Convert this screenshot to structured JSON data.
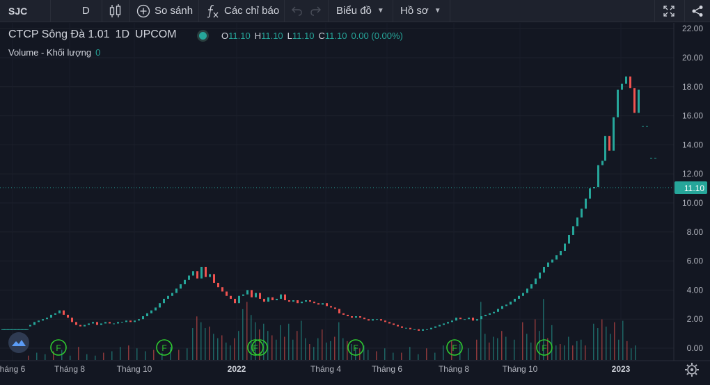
{
  "toolbar": {
    "symbol": "SJC",
    "interval": "D",
    "compare_label": "So sánh",
    "indicators_label": "Các chỉ báo",
    "chart_label": "Biểu đồ",
    "profile_label": "Hồ sơ"
  },
  "legend": {
    "name": "CTCP Sông Đà 1.01",
    "interval": "1D",
    "exchange": "UPCOM",
    "o_label": "O",
    "o": "11.10",
    "h_label": "H",
    "h": "11.10",
    "l_label": "L",
    "l": "11.10",
    "c_label": "C",
    "c": "11.10",
    "change": "0.00 (0.00%)",
    "volume_label": "Volume - Khối lượng",
    "volume_value": "0"
  },
  "colors": {
    "up": "#26a69a",
    "down": "#ef5350",
    "accent": "#26a69a",
    "bg": "#131722",
    "event": "#2fcc2f"
  },
  "chart_data": {
    "type": "candlestick",
    "y_ticks": [
      "22.00",
      "20.00",
      "18.00",
      "16.00",
      "14.00",
      "12.00",
      "10.00",
      "8.00",
      "6.00",
      "4.00",
      "2.00",
      "0.00"
    ],
    "ylim": [
      0,
      22
    ],
    "current_price_label": "11.10",
    "current_price": 11.1,
    "x_labels": [
      "háng 6",
      "Tháng 8",
      "Tháng 10",
      "2022",
      "Tháng 4",
      "Tháng 6",
      "Tháng 8",
      "Tháng 10",
      "2023"
    ],
    "event_markers": [
      "F",
      "F",
      "F",
      "F",
      "F",
      "F"
    ],
    "price_series": [
      [
        2,
        1.3,
        1.3
      ],
      [
        4,
        1.3,
        1.3
      ],
      [
        6,
        1.3,
        1.3
      ],
      [
        8,
        1.3,
        1.3
      ],
      [
        10,
        1.3,
        1.3
      ],
      [
        12,
        1.3,
        1.3
      ],
      [
        14,
        1.3,
        1.3
      ],
      [
        16,
        1.3,
        1.3
      ],
      [
        18,
        1.3,
        1.3
      ],
      [
        20,
        1.3,
        1.3
      ],
      [
        22,
        1.3,
        1.3
      ],
      [
        24,
        1.3,
        1.3
      ],
      [
        26,
        1.3,
        1.3
      ],
      [
        28,
        1.3,
        1.3
      ],
      [
        30,
        1.3,
        1.3
      ],
      [
        32,
        1.3,
        1.3
      ],
      [
        34,
        1.3,
        1.3
      ],
      [
        36,
        1.3,
        1.3
      ],
      [
        38,
        1.3,
        1.3
      ],
      [
        42,
        1.5,
        1.6
      ],
      [
        48,
        1.6,
        1.8
      ],
      [
        54,
        1.8,
        1.9
      ],
      [
        60,
        1.9,
        2.0
      ],
      [
        66,
        2.0,
        2.1
      ],
      [
        72,
        2.1,
        2.3
      ],
      [
        78,
        2.3,
        2.4
      ],
      [
        84,
        2.4,
        2.6
      ],
      [
        90,
        2.6,
        2.3
      ],
      [
        96,
        2.3,
        2.1
      ],
      [
        102,
        2.1,
        1.8
      ],
      [
        108,
        1.8,
        1.6
      ],
      [
        114,
        1.6,
        1.5
      ],
      [
        120,
        1.5,
        1.6
      ],
      [
        126,
        1.6,
        1.7
      ],
      [
        132,
        1.7,
        1.8
      ],
      [
        138,
        1.8,
        1.6
      ],
      [
        144,
        1.6,
        1.7
      ],
      [
        150,
        1.7,
        1.8
      ],
      [
        156,
        1.8,
        1.7
      ],
      [
        162,
        1.7,
        1.7
      ],
      [
        168,
        1.7,
        1.8
      ],
      [
        174,
        1.8,
        1.8
      ],
      [
        180,
        1.8,
        1.9
      ],
      [
        186,
        1.9,
        1.8
      ],
      [
        192,
        1.8,
        1.9
      ],
      [
        198,
        1.9,
        2.0
      ],
      [
        204,
        2.0,
        2.2
      ],
      [
        210,
        2.2,
        2.4
      ],
      [
        216,
        2.4,
        2.6
      ],
      [
        222,
        2.6,
        2.8
      ],
      [
        228,
        2.8,
        3.1
      ],
      [
        234,
        3.1,
        3.4
      ],
      [
        240,
        3.4,
        3.6
      ],
      [
        246,
        3.6,
        3.8
      ],
      [
        252,
        3.8,
        4.1
      ],
      [
        258,
        4.1,
        4.4
      ],
      [
        264,
        4.4,
        4.7
      ],
      [
        270,
        4.7,
        5.0
      ],
      [
        276,
        5.0,
        5.3
      ],
      [
        282,
        5.3,
        4.8
      ],
      [
        288,
        4.8,
        5.6
      ],
      [
        294,
        5.6,
        4.9
      ],
      [
        300,
        4.9,
        5.1
      ],
      [
        306,
        5.1,
        4.5
      ],
      [
        312,
        4.5,
        4.2
      ],
      [
        318,
        4.2,
        3.9
      ],
      [
        324,
        3.9,
        3.6
      ],
      [
        330,
        3.6,
        3.4
      ],
      [
        336,
        3.4,
        3.1
      ],
      [
        342,
        3.1,
        3.6
      ],
      [
        348,
        3.6,
        3.7
      ],
      [
        354,
        3.7,
        4.0
      ],
      [
        360,
        4.0,
        3.5
      ],
      [
        366,
        3.5,
        3.8
      ],
      [
        372,
        3.8,
        3.4
      ],
      [
        378,
        3.4,
        3.2
      ],
      [
        384,
        3.2,
        3.5
      ],
      [
        390,
        3.5,
        3.3
      ],
      [
        396,
        3.3,
        3.4
      ],
      [
        402,
        3.4,
        3.7
      ],
      [
        408,
        3.7,
        3.3
      ],
      [
        414,
        3.3,
        3.2
      ],
      [
        420,
        3.2,
        3.3
      ],
      [
        426,
        3.3,
        3.1
      ],
      [
        432,
        3.1,
        3.2
      ],
      [
        438,
        3.2,
        3.3
      ],
      [
        444,
        3.3,
        3.2
      ],
      [
        450,
        3.2,
        3.1
      ],
      [
        456,
        3.1,
        3.0
      ],
      [
        462,
        3.0,
        3.1
      ],
      [
        468,
        3.1,
        2.9
      ],
      [
        474,
        2.9,
        2.8
      ],
      [
        480,
        2.8,
        2.7
      ],
      [
        486,
        2.7,
        2.4
      ],
      [
        492,
        2.4,
        2.3
      ],
      [
        498,
        2.3,
        2.2
      ],
      [
        504,
        2.2,
        2.1
      ],
      [
        510,
        2.1,
        2.2
      ],
      [
        516,
        2.2,
        2.1
      ],
      [
        522,
        2.1,
        2.0
      ],
      [
        528,
        2.0,
        1.9
      ],
      [
        534,
        1.9,
        2.0
      ],
      [
        540,
        2.0,
        2.0
      ],
      [
        546,
        2.0,
        1.9
      ],
      [
        552,
        1.9,
        1.8
      ],
      [
        558,
        1.8,
        1.7
      ],
      [
        564,
        1.7,
        1.6
      ],
      [
        570,
        1.6,
        1.5
      ],
      [
        576,
        1.5,
        1.4
      ],
      [
        582,
        1.4,
        1.4
      ],
      [
        588,
        1.4,
        1.3
      ],
      [
        594,
        1.3,
        1.3
      ],
      [
        600,
        1.3,
        1.2
      ],
      [
        606,
        1.2,
        1.3
      ],
      [
        612,
        1.3,
        1.3
      ],
      [
        618,
        1.3,
        1.4
      ],
      [
        624,
        1.4,
        1.5
      ],
      [
        630,
        1.5,
        1.6
      ],
      [
        636,
        1.6,
        1.7
      ],
      [
        642,
        1.7,
        1.8
      ],
      [
        648,
        1.8,
        1.9
      ],
      [
        654,
        1.9,
        2.1
      ],
      [
        660,
        2.1,
        2.0
      ],
      [
        666,
        2.0,
        2.0
      ],
      [
        672,
        2.0,
        2.1
      ],
      [
        678,
        2.1,
        1.9
      ],
      [
        684,
        1.9,
        2.0
      ],
      [
        690,
        2.0,
        2.2
      ],
      [
        696,
        2.2,
        2.3
      ],
      [
        702,
        2.3,
        2.4
      ],
      [
        708,
        2.4,
        2.5
      ],
      [
        714,
        2.5,
        2.7
      ],
      [
        720,
        2.7,
        2.9
      ],
      [
        726,
        2.9,
        3.0
      ],
      [
        732,
        3.0,
        3.2
      ],
      [
        738,
        3.2,
        3.4
      ],
      [
        744,
        3.4,
        3.6
      ],
      [
        750,
        3.6,
        3.8
      ],
      [
        756,
        3.8,
        4.1
      ],
      [
        762,
        4.1,
        4.4
      ],
      [
        768,
        4.4,
        4.8
      ],
      [
        774,
        4.8,
        5.2
      ],
      [
        780,
        5.2,
        5.6
      ],
      [
        786,
        5.6,
        5.9
      ],
      [
        792,
        5.9,
        6.1
      ],
      [
        798,
        6.1,
        6.4
      ],
      [
        804,
        6.4,
        6.7
      ],
      [
        810,
        6.7,
        7.2
      ],
      [
        816,
        7.2,
        7.8
      ],
      [
        822,
        7.8,
        8.4
      ],
      [
        828,
        8.4,
        9.0
      ],
      [
        834,
        9.0,
        9.6
      ],
      [
        840,
        9.6,
        10.3
      ],
      [
        846,
        10.3,
        11.0
      ],
      [
        852,
        11.0,
        11.1
      ],
      [
        858,
        11.1,
        12.6
      ],
      [
        864,
        12.6,
        12.9
      ],
      [
        868,
        12.9,
        14.6
      ],
      [
        874,
        14.6,
        13.6
      ],
      [
        880,
        13.6,
        15.9
      ],
      [
        886,
        15.9,
        17.8
      ],
      [
        892,
        17.8,
        18.2
      ],
      [
        898,
        18.2,
        18.7
      ],
      [
        904,
        18.7,
        17.9
      ],
      [
        910,
        17.9,
        16.2
      ],
      [
        916,
        16.2,
        17.8
      ],
      [
        922,
        15.3,
        15.3
      ],
      [
        928,
        15.3,
        15.3
      ],
      [
        934,
        13.1,
        13.1
      ],
      [
        940,
        13.1,
        13.1
      ]
    ],
    "volume_series": [
      [
        40,
        0.3
      ],
      [
        52,
        0.5
      ],
      [
        64,
        0.4
      ],
      [
        76,
        0.6
      ],
      [
        88,
        0.7
      ],
      [
        100,
        0.3
      ],
      [
        112,
        0.9
      ],
      [
        124,
        0.4
      ],
      [
        136,
        0.3
      ],
      [
        148,
        0.5
      ],
      [
        160,
        0.6
      ],
      [
        172,
        0.9
      ],
      [
        184,
        1.0
      ],
      [
        196,
        0.8
      ],
      [
        208,
        0.6
      ],
      [
        220,
        0.7
      ],
      [
        232,
        0.5
      ],
      [
        244,
        0.9
      ],
      [
        256,
        0.7
      ],
      [
        268,
        0.8
      ],
      [
        276,
        2.2
      ],
      [
        282,
        3.0
      ],
      [
        288,
        2.6
      ],
      [
        294,
        2.2
      ],
      [
        300,
        2.3
      ],
      [
        306,
        1.8
      ],
      [
        312,
        1.5
      ],
      [
        318,
        1.7
      ],
      [
        324,
        1.2
      ],
      [
        330,
        1.0
      ],
      [
        336,
        1.5
      ],
      [
        342,
        2.0
      ],
      [
        348,
        3.5
      ],
      [
        354,
        4.0
      ],
      [
        360,
        3.1
      ],
      [
        366,
        2.6
      ],
      [
        372,
        2.1
      ],
      [
        378,
        2.5
      ],
      [
        384,
        2.0
      ],
      [
        390,
        1.7
      ],
      [
        396,
        1.4
      ],
      [
        402,
        2.4
      ],
      [
        408,
        1.6
      ],
      [
        414,
        2.5
      ],
      [
        420,
        1.4
      ],
      [
        426,
        2.0
      ],
      [
        432,
        2.7
      ],
      [
        438,
        1.5
      ],
      [
        444,
        1.1
      ],
      [
        450,
        0.9
      ],
      [
        456,
        1.5
      ],
      [
        462,
        2.1
      ],
      [
        468,
        1.2
      ],
      [
        474,
        1.3
      ],
      [
        480,
        1.6
      ],
      [
        486,
        2.6
      ],
      [
        492,
        1.5
      ],
      [
        498,
        1.3
      ],
      [
        504,
        1.1
      ],
      [
        510,
        0.9
      ],
      [
        516,
        0.8
      ],
      [
        522,
        1.0
      ],
      [
        528,
        0.7
      ],
      [
        540,
        0.6
      ],
      [
        552,
        0.8
      ],
      [
        564,
        0.5
      ],
      [
        576,
        0.5
      ],
      [
        588,
        0.9
      ],
      [
        600,
        0.4
      ],
      [
        612,
        0.8
      ],
      [
        624,
        0.5
      ],
      [
        636,
        1.0
      ],
      [
        648,
        1.3
      ],
      [
        660,
        1.1
      ],
      [
        672,
        0.8
      ],
      [
        684,
        1.4
      ],
      [
        690,
        4.0
      ],
      [
        696,
        1.8
      ],
      [
        702,
        1.2
      ],
      [
        708,
        1.6
      ],
      [
        714,
        1.5
      ],
      [
        720,
        2.0
      ],
      [
        726,
        1.6
      ],
      [
        738,
        1.4
      ],
      [
        750,
        2.6
      ],
      [
        756,
        1.8
      ],
      [
        762,
        1.2
      ],
      [
        768,
        2.8
      ],
      [
        774,
        2.0
      ],
      [
        780,
        4.2
      ],
      [
        786,
        1.5
      ],
      [
        792,
        2.4
      ],
      [
        798,
        1.0
      ],
      [
        804,
        1.1
      ],
      [
        810,
        1.0
      ],
      [
        816,
        1.6
      ],
      [
        822,
        1.0
      ],
      [
        828,
        1.3
      ],
      [
        834,
        1.4
      ],
      [
        840,
        1.0
      ],
      [
        852,
        2.5
      ],
      [
        858,
        2.2
      ],
      [
        864,
        2.8
      ],
      [
        870,
        2.3
      ],
      [
        876,
        1.8
      ],
      [
        882,
        2.6
      ],
      [
        888,
        1.4
      ],
      [
        894,
        2.7
      ],
      [
        900,
        1.3
      ],
      [
        906,
        0.8
      ],
      [
        912,
        1.0
      ]
    ]
  }
}
